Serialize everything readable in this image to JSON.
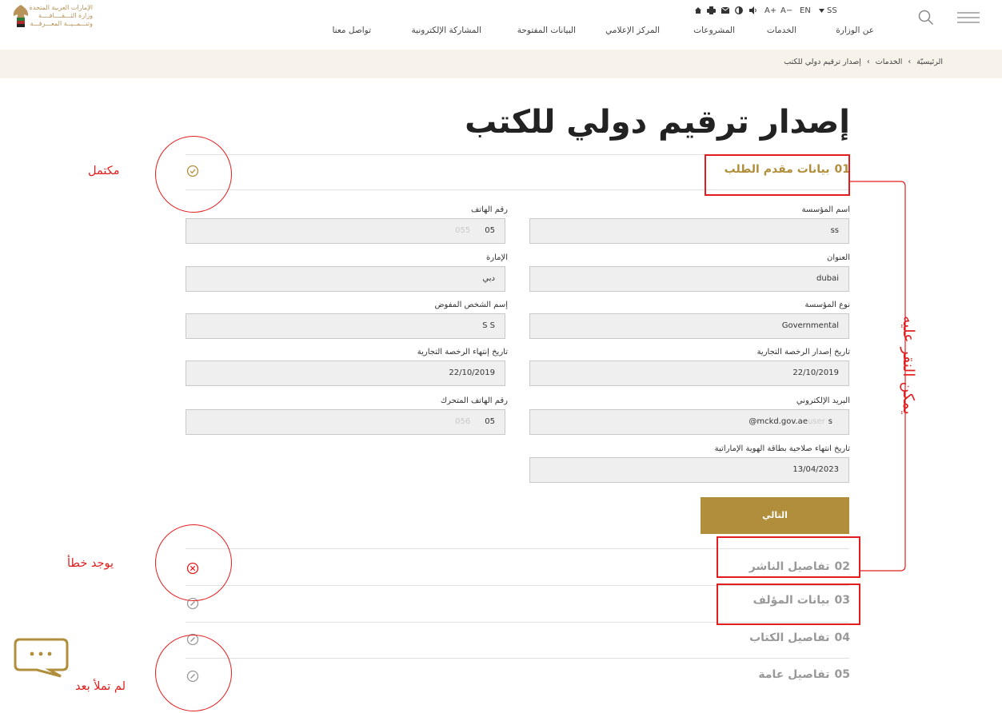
{
  "header": {
    "logo_text": [
      "الإمارات العربية المتحدة",
      "وزارة الثـــقــــافــــة",
      "وتنـــمــيــة المعـــرفـــة"
    ],
    "nav": [
      "عن الوزارة",
      "الخدمات",
      "المشروعات",
      "المركز الإعلامي",
      "البيانات المفتوحة",
      "المشاركة الإلكترونية",
      "تواصل معنا"
    ],
    "topbar": {
      "font_increase": "A+",
      "font_decrease": "A−",
      "language": "EN",
      "user": "SS",
      "icons": [
        "home-icon",
        "print-icon",
        "mail-icon",
        "contrast-icon",
        "audio-icon"
      ]
    }
  },
  "breadcrumb": [
    "الرئيسيّة",
    "الخدمات",
    "إصدار ترقيم دولي للكتب"
  ],
  "breadcrumb_separator": "›",
  "page_title": "إصدار ترقيم دولي للكتب",
  "steps": [
    {
      "num": "01",
      "label": "بيانات مقدم الطلب",
      "status": "complete",
      "status_icon": "check-circle-icon",
      "color": "#b18e3c"
    },
    {
      "num": "02",
      "label": "تفاصيل الناشر",
      "status": "error",
      "status_icon": "error-circle-icon",
      "color": "#999999"
    },
    {
      "num": "03",
      "label": "بيانات المؤلف",
      "status": "not-filled",
      "status_icon": "pencil-circle-icon",
      "color": "#999999"
    },
    {
      "num": "04",
      "label": "تفاصيل الكتاب",
      "status": "not-filled",
      "status_icon": "pencil-circle-icon",
      "color": "#999999"
    },
    {
      "num": "05",
      "label": "تفاصيل عامة",
      "status": "not-filled",
      "status_icon": "pencil-circle-icon",
      "color": "#999999"
    }
  ],
  "form": {
    "org_name": {
      "label": "اسم المؤسسة",
      "value": "ss"
    },
    "phone": {
      "label": "رقم الهاتف",
      "value": "05",
      "ghost": "055"
    },
    "address": {
      "label": "العنوان",
      "value": "dubai"
    },
    "emirate": {
      "label": "الإمارة",
      "value": "دبي"
    },
    "org_type": {
      "label": "نوع المؤسسة",
      "value": "Governmental"
    },
    "authorized_person": {
      "label": "إسم الشخص المفوض",
      "value": "S S"
    },
    "license_issue": {
      "label": "تاريخ إصدار الرخصة التجارية",
      "value": "22/10/2019"
    },
    "license_expiry": {
      "label": "تاريخ إنتهاء الرخصة التجارية",
      "value": "22/10/2019"
    },
    "email": {
      "label": "البريد الإلكتروني",
      "value": "@mckd.gov.ae",
      "prefix": "s",
      "ghost": "user"
    },
    "mobile": {
      "label": "رقم الهاتف المتحرك",
      "value": "05",
      "ghost": "056"
    },
    "eid_expiry": {
      "label": "تاريخ انتهاء صلاحية بطاقة الهوية الإماراتية",
      "value": "13/04/2023"
    },
    "next_label": "التالي"
  },
  "annotations": {
    "complete": "مكتمل",
    "error": "يوجد خطأ",
    "not_filled": "لم تملأ بعد",
    "clickable": "يمكن النقر عليه"
  },
  "colors": {
    "accent": "#b18e3c",
    "annotation": "#e31d1d",
    "breadcrumb_bg": "#f7f3ea"
  }
}
